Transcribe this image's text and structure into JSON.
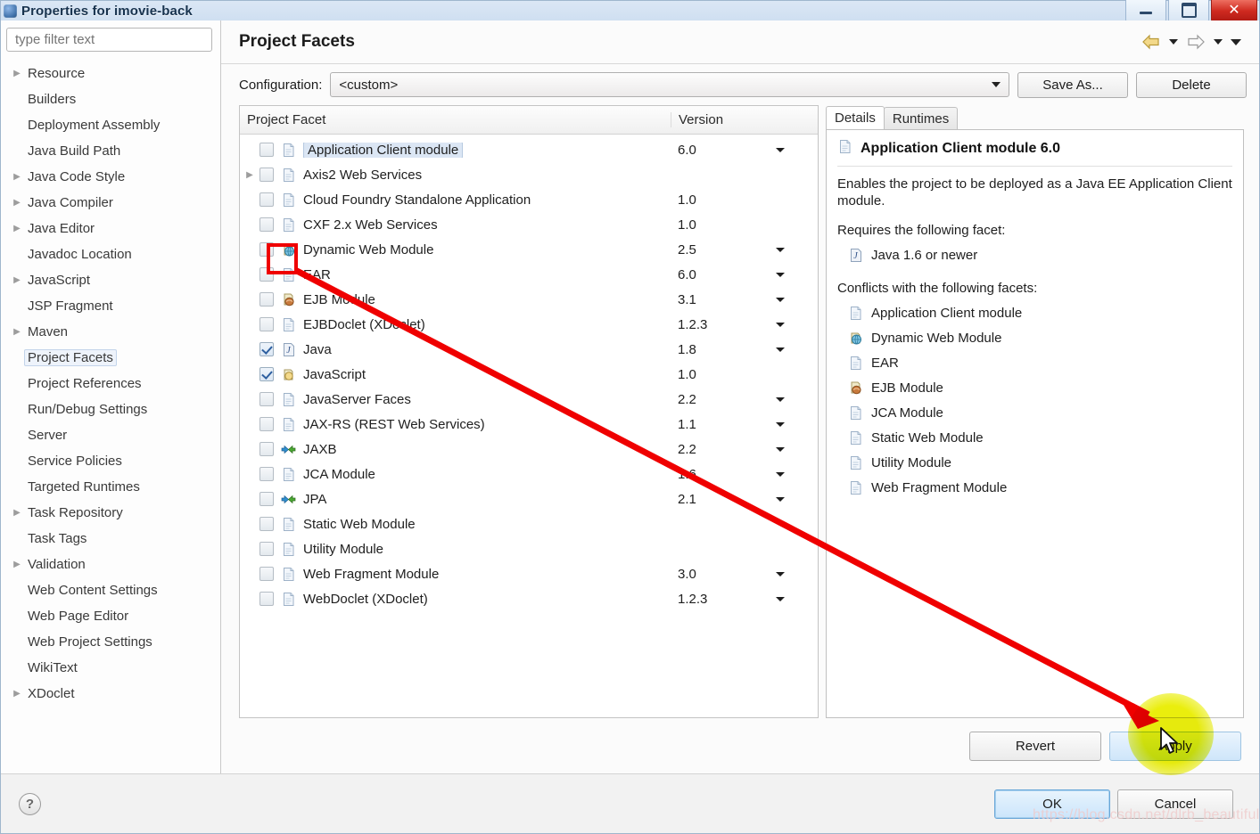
{
  "window": {
    "title": "Properties for imovie-back",
    "buttons": {
      "minimize": "minimize-button",
      "maximize": "maximize-button",
      "close": "✕"
    }
  },
  "sidebar": {
    "filter_placeholder": "type filter text",
    "filter_value": "",
    "items": [
      {
        "label": "Resource",
        "expandable": true,
        "selected": false
      },
      {
        "label": "Builders",
        "expandable": false,
        "selected": false
      },
      {
        "label": "Deployment Assembly",
        "expandable": false,
        "selected": false
      },
      {
        "label": "Java Build Path",
        "expandable": false,
        "selected": false
      },
      {
        "label": "Java Code Style",
        "expandable": true,
        "selected": false
      },
      {
        "label": "Java Compiler",
        "expandable": true,
        "selected": false
      },
      {
        "label": "Java Editor",
        "expandable": true,
        "selected": false
      },
      {
        "label": "Javadoc Location",
        "expandable": false,
        "selected": false
      },
      {
        "label": "JavaScript",
        "expandable": true,
        "selected": false
      },
      {
        "label": "JSP Fragment",
        "expandable": false,
        "selected": false
      },
      {
        "label": "Maven",
        "expandable": true,
        "selected": false
      },
      {
        "label": "Project Facets",
        "expandable": false,
        "selected": true
      },
      {
        "label": "Project References",
        "expandable": false,
        "selected": false
      },
      {
        "label": "Run/Debug Settings",
        "expandable": false,
        "selected": false
      },
      {
        "label": "Server",
        "expandable": false,
        "selected": false
      },
      {
        "label": "Service Policies",
        "expandable": false,
        "selected": false
      },
      {
        "label": "Targeted Runtimes",
        "expandable": false,
        "selected": false
      },
      {
        "label": "Task Repository",
        "expandable": true,
        "selected": false
      },
      {
        "label": "Task Tags",
        "expandable": false,
        "selected": false
      },
      {
        "label": "Validation",
        "expandable": true,
        "selected": false
      },
      {
        "label": "Web Content Settings",
        "expandable": false,
        "selected": false
      },
      {
        "label": "Web Page Editor",
        "expandable": false,
        "selected": false
      },
      {
        "label": "Web Project Settings",
        "expandable": false,
        "selected": false
      },
      {
        "label": "WikiText",
        "expandable": false,
        "selected": false
      },
      {
        "label": "XDoclet",
        "expandable": true,
        "selected": false
      }
    ]
  },
  "page": {
    "title": "Project Facets",
    "nav": {
      "back_icon": "back-arrow-icon",
      "back_menu_icon": "chevron-down-icon",
      "forward_icon": "forward-arrow-icon",
      "forward_menu_icon": "chevron-down-icon",
      "menu_icon": "chevron-down-icon"
    }
  },
  "configuration": {
    "label": "Configuration:",
    "value": "<custom>",
    "save_as_label": "Save As...",
    "delete_label": "Delete"
  },
  "facet_table": {
    "columns": [
      "Project Facet",
      "Version",
      ""
    ],
    "rows": [
      {
        "name": "Application Client module",
        "version": "6.0",
        "checked": false,
        "expandable": false,
        "selected": true,
        "has_version_menu": true,
        "icon": "document-icon"
      },
      {
        "name": "Axis2 Web Services",
        "version": "",
        "checked": false,
        "expandable": true,
        "selected": false,
        "has_version_menu": false,
        "icon": "document-icon"
      },
      {
        "name": "Cloud Foundry Standalone Application",
        "version": "1.0",
        "checked": false,
        "expandable": false,
        "selected": false,
        "has_version_menu": false,
        "icon": "document-icon"
      },
      {
        "name": "CXF 2.x Web Services",
        "version": "1.0",
        "checked": false,
        "expandable": false,
        "selected": false,
        "has_version_menu": false,
        "icon": "document-icon"
      },
      {
        "name": "Dynamic Web Module",
        "version": "2.5",
        "checked": false,
        "expandable": false,
        "selected": false,
        "has_version_menu": true,
        "icon": "globe-jar-icon"
      },
      {
        "name": "EAR",
        "version": "6.0",
        "checked": false,
        "expandable": false,
        "selected": false,
        "has_version_menu": true,
        "icon": "document-icon"
      },
      {
        "name": "EJB Module",
        "version": "3.1",
        "checked": false,
        "expandable": false,
        "selected": false,
        "has_version_menu": true,
        "icon": "bean-jar-icon"
      },
      {
        "name": "EJBDoclet (XDoclet)",
        "version": "1.2.3",
        "checked": false,
        "expandable": false,
        "selected": false,
        "has_version_menu": true,
        "icon": "document-icon"
      },
      {
        "name": "Java",
        "version": "1.8",
        "checked": true,
        "expandable": false,
        "selected": false,
        "has_version_menu": true,
        "icon": "java-icon"
      },
      {
        "name": "JavaScript",
        "version": "1.0",
        "checked": true,
        "expandable": false,
        "selected": false,
        "has_version_menu": false,
        "icon": "js-icon"
      },
      {
        "name": "JavaServer Faces",
        "version": "2.2",
        "checked": false,
        "expandable": false,
        "selected": false,
        "has_version_menu": true,
        "icon": "document-icon"
      },
      {
        "name": "JAX-RS (REST Web Services)",
        "version": "1.1",
        "checked": false,
        "expandable": false,
        "selected": false,
        "has_version_menu": true,
        "icon": "document-icon"
      },
      {
        "name": "JAXB",
        "version": "2.2",
        "checked": false,
        "expandable": false,
        "selected": false,
        "has_version_menu": true,
        "icon": "arrows-icon"
      },
      {
        "name": "JCA Module",
        "version": "1.6",
        "checked": false,
        "expandable": false,
        "selected": false,
        "has_version_menu": true,
        "icon": "document-icon"
      },
      {
        "name": "JPA",
        "version": "2.1",
        "checked": false,
        "expandable": false,
        "selected": false,
        "has_version_menu": true,
        "icon": "arrows-icon"
      },
      {
        "name": "Static Web Module",
        "version": "",
        "checked": false,
        "expandable": false,
        "selected": false,
        "has_version_menu": false,
        "icon": "document-icon"
      },
      {
        "name": "Utility Module",
        "version": "",
        "checked": false,
        "expandable": false,
        "selected": false,
        "has_version_menu": false,
        "icon": "document-icon"
      },
      {
        "name": "Web Fragment Module",
        "version": "3.0",
        "checked": false,
        "expandable": false,
        "selected": false,
        "has_version_menu": true,
        "icon": "document-icon"
      },
      {
        "name": "WebDoclet (XDoclet)",
        "version": "1.2.3",
        "checked": false,
        "expandable": false,
        "selected": false,
        "has_version_menu": true,
        "icon": "document-icon"
      }
    ]
  },
  "details": {
    "tabs": [
      {
        "label": "Details",
        "active": true
      },
      {
        "label": "Runtimes",
        "active": false
      }
    ],
    "heading": "Application Client module 6.0",
    "description": "Enables the project to be deployed as a Java EE Application Client module.",
    "requires_label": "Requires the following facet:",
    "requires": [
      {
        "label": "Java 1.6 or newer",
        "icon": "java-icon"
      }
    ],
    "conflicts_label": "Conflicts with the following facets:",
    "conflicts": [
      {
        "label": "Application Client module",
        "icon": "document-icon"
      },
      {
        "label": "Dynamic Web Module",
        "icon": "globe-jar-icon"
      },
      {
        "label": "EAR",
        "icon": "document-icon"
      },
      {
        "label": "EJB Module",
        "icon": "bean-jar-icon"
      },
      {
        "label": "JCA Module",
        "icon": "document-icon"
      },
      {
        "label": "Static Web Module",
        "icon": "document-icon"
      },
      {
        "label": "Utility Module",
        "icon": "document-icon"
      },
      {
        "label": "Web Fragment Module",
        "icon": "document-icon"
      }
    ]
  },
  "footer": {
    "revert_label": "Revert",
    "apply_label": "Apply",
    "help_label": "?",
    "ok_label": "OK",
    "cancel_label": "Cancel"
  },
  "annotations": {
    "watermark": "https://blog.csdn.net/dlrb_beautiful",
    "highlight_color": "#e9ed00",
    "arrow_color": "#ef0000"
  }
}
